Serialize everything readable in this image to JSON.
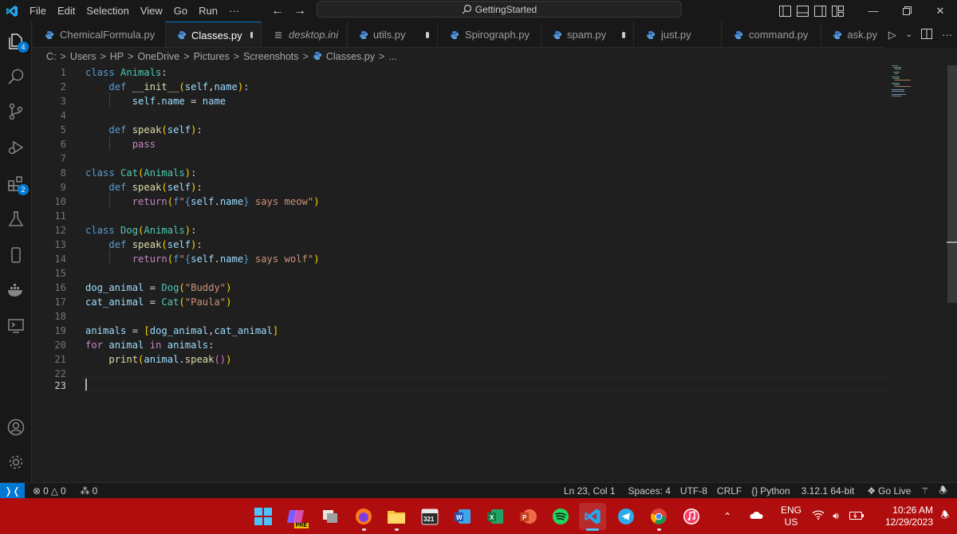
{
  "menu": [
    "File",
    "Edit",
    "Selection",
    "View",
    "Go",
    "Run",
    "···"
  ],
  "command_center": "GettingStarted",
  "tabs": [
    {
      "label": "ChemicalFormula.py",
      "icon": "python-icon",
      "active": false,
      "modified": false
    },
    {
      "label": "Classes.py",
      "icon": "python-icon",
      "active": true,
      "modified": true
    },
    {
      "label": "desktop.ini",
      "icon": "settings-file-icon",
      "active": false,
      "modified": false,
      "italic": true
    },
    {
      "label": "utils.py",
      "icon": "python-icon",
      "active": false,
      "modified": true
    },
    {
      "label": "Spirograph.py",
      "icon": "python-icon",
      "active": false,
      "modified": false
    },
    {
      "label": "spam.py",
      "icon": "python-icon",
      "active": false,
      "modified": true
    },
    {
      "label": "just.py",
      "icon": "python-icon",
      "active": false,
      "modified": false
    },
    {
      "label": "command.py",
      "icon": "python-icon",
      "active": false,
      "modified": false
    },
    {
      "label": "ask.py",
      "icon": "python-icon",
      "active": false,
      "modified": false
    }
  ],
  "breadcrumb": [
    "C:",
    "Users",
    "HP",
    "OneDrive",
    "Pictures",
    "Screenshots",
    "Classes.py",
    "..."
  ],
  "activity_badges": {
    "explorer": "4",
    "extensions": "2"
  },
  "editor": {
    "line_numbers": [
      "1",
      "2",
      "3",
      "4",
      "5",
      "6",
      "7",
      "8",
      "9",
      "10",
      "11",
      "12",
      "13",
      "14",
      "15",
      "16",
      "17",
      "18",
      "19",
      "20",
      "21",
      "22",
      "23"
    ],
    "current_line": "23"
  },
  "status": {
    "errors": "0",
    "warnings": "0",
    "ports": "0",
    "position": "Ln 23, Col 1",
    "spaces": "Spaces: 4",
    "encoding": "UTF-8",
    "eol": "CRLF",
    "language": "Python",
    "interpreter": "3.12.1 64-bit",
    "golive": "Go Live"
  },
  "taskbar": {
    "lang1": "ENG",
    "lang2": "US",
    "time": "10:26 AM",
    "date": "12/29/2023",
    "calendar_badge": "321",
    "pre_badge": "PRE"
  },
  "colors": {
    "accent": "#0078d4",
    "taskbar": "#b00e0e",
    "keyword": "#569cd6",
    "class": "#4ec9b0",
    "string": "#ce9178"
  }
}
